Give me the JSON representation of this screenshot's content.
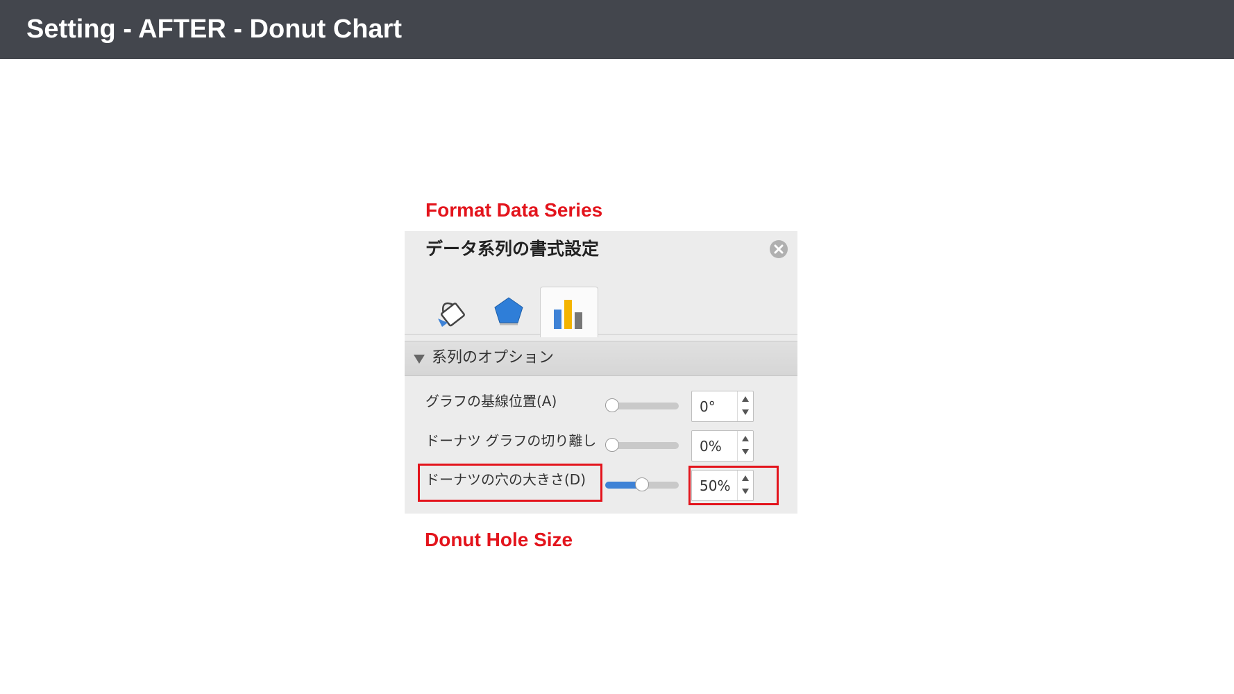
{
  "header": {
    "title": "Setting - AFTER - Donut Chart"
  },
  "annotations": {
    "top": "Format Data Series",
    "bottom": "Donut Hole Size"
  },
  "panel": {
    "title": "データ系列の書式設定",
    "tabs": [
      {
        "icon": "paint-bucket-icon",
        "selected": false
      },
      {
        "icon": "pentagon-icon",
        "selected": false
      },
      {
        "icon": "bar-chart-icon",
        "selected": true
      }
    ],
    "section": {
      "label": "系列のオプション",
      "expanded": true
    },
    "rows": [
      {
        "label": "グラフの基線位置(A)",
        "value": "0°",
        "slider_fraction": 0
      },
      {
        "label": "ドーナツ グラフの切り離し",
        "value": "0%",
        "slider_fraction": 0
      },
      {
        "label": "ドーナツの穴の大きさ(D)",
        "value": "50%",
        "slider_fraction": 0.5
      }
    ]
  },
  "colors": {
    "header_bg": "#43464d",
    "annotation": "#e3141c",
    "panel_bg": "#ececec",
    "accent_blue": "#3e82d6",
    "chart_yellow": "#f4b400",
    "chart_gray": "#777777"
  }
}
